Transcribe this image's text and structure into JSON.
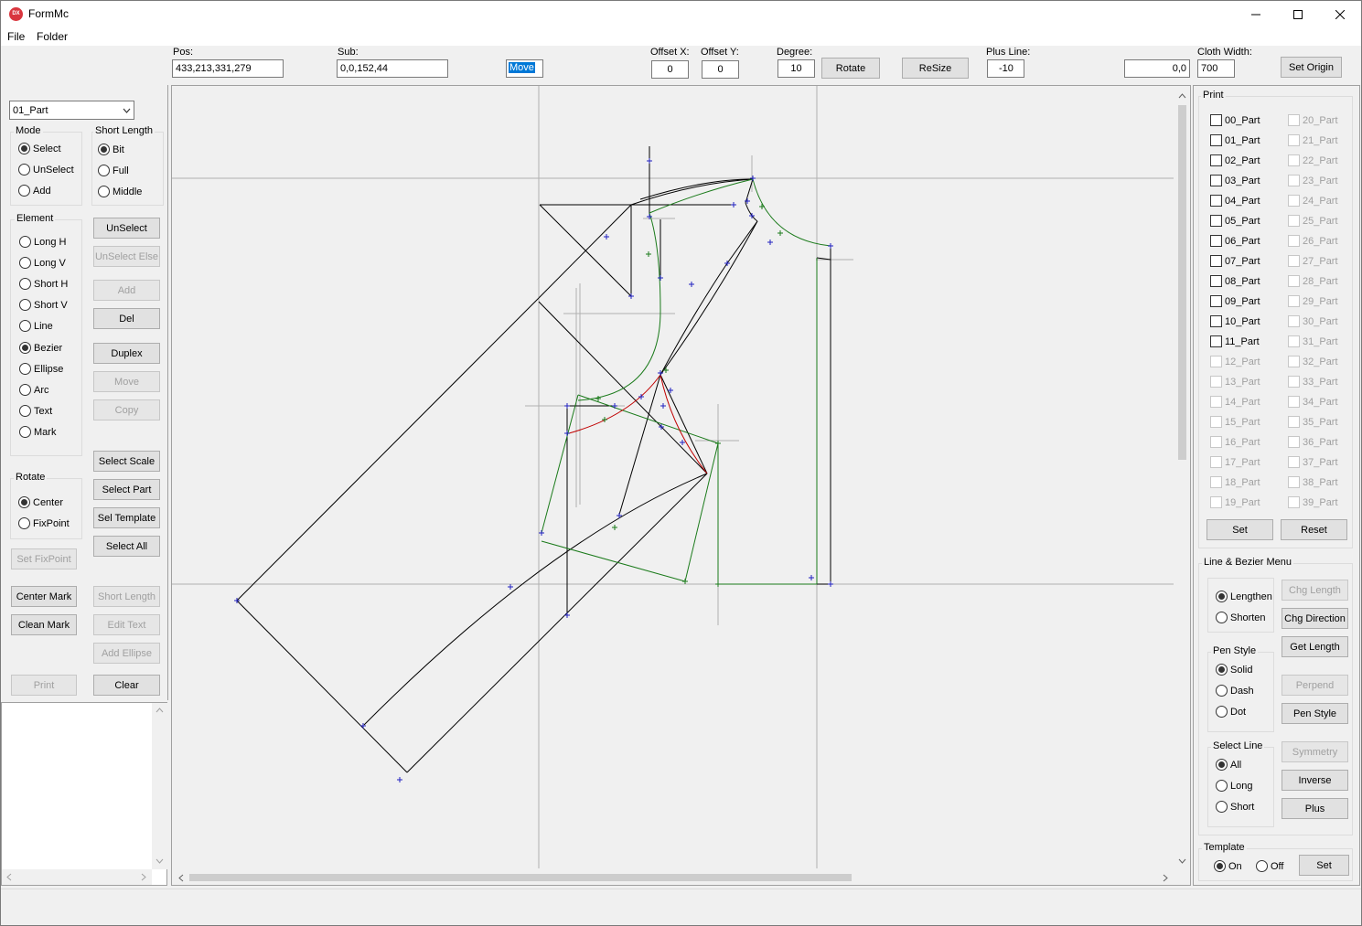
{
  "window": {
    "title": "FormMc",
    "icon": "app-icon"
  },
  "menu": {
    "file": "File",
    "folder": "Folder"
  },
  "toolbar": {
    "pos_label": "Pos:",
    "pos_value": "433,213,331,279",
    "sub_label": "Sub:",
    "sub_value": "0,0,152,44",
    "mode_value": "Move",
    "offset_x_label": "Offset X:",
    "offset_x_value": "0",
    "offset_y_label": "Offset Y:",
    "offset_y_value": "0",
    "degree_label": "Degree:",
    "degree_value": "10",
    "rotate_button": "Rotate",
    "resize_button": "ReSize",
    "plus_line_label": "Plus Line:",
    "plus_line_value": "-10",
    "origin_value": "0,0",
    "cloth_width_label": "Cloth Width:",
    "cloth_width_value": "700",
    "set_origin_button": "Set Origin"
  },
  "left": {
    "part_select": "01_Part",
    "mode": {
      "title": "Mode",
      "options": [
        "Select",
        "UnSelect",
        "Add"
      ],
      "selected": "Select"
    },
    "short_length": {
      "title": "Short Length",
      "options": [
        "Bit",
        "Full",
        "Middle"
      ],
      "selected": "Bit"
    },
    "element": {
      "title": "Element",
      "options": [
        "Long H",
        "Long V",
        "Short H",
        "Short V",
        "Line",
        "Bezier",
        "Ellipse",
        "Arc",
        "Text",
        "Mark"
      ],
      "selected": "Bezier"
    },
    "buttons": {
      "unselect": "UnSelect",
      "unselect_else": "UnSelect Else",
      "add": "Add",
      "del": "Del",
      "duplex": "Duplex",
      "move": "Move",
      "copy": "Copy",
      "select_scale": "Select Scale",
      "select_part": "Select Part",
      "sel_template": "Sel Template",
      "select_all": "Select All",
      "set_fixpoint": "Set FixPoint",
      "center_mark": "Center Mark",
      "short_length": "Short Length",
      "clean_mark": "Clean Mark",
      "edit_text": "Edit Text",
      "add_ellipse": "Add Ellipse",
      "print": "Print",
      "clear": "Clear"
    },
    "rotate": {
      "title": "Rotate",
      "options": [
        "Center",
        "FixPoint"
      ],
      "selected": "Center"
    }
  },
  "right": {
    "print": {
      "title": "Print",
      "parts_left": [
        "00_Part",
        "01_Part",
        "02_Part",
        "03_Part",
        "04_Part",
        "05_Part",
        "06_Part",
        "07_Part",
        "08_Part",
        "09_Part",
        "10_Part",
        "11_Part",
        "12_Part",
        "13_Part",
        "14_Part",
        "15_Part",
        "16_Part",
        "17_Part",
        "18_Part",
        "19_Part"
      ],
      "parts_right": [
        "20_Part",
        "21_Part",
        "22_Part",
        "23_Part",
        "24_Part",
        "25_Part",
        "26_Part",
        "27_Part",
        "28_Part",
        "29_Part",
        "30_Part",
        "31_Part",
        "32_Part",
        "33_Part",
        "34_Part",
        "35_Part",
        "36_Part",
        "37_Part",
        "38_Part",
        "39_Part"
      ],
      "enabled_count": 12,
      "set_button": "Set",
      "reset_button": "Reset"
    },
    "line_menu": {
      "title": "Line & Bezier Menu",
      "length_options": [
        "Lengthen",
        "Shorten"
      ],
      "length_selected": "Lengthen",
      "chg_length": "Chg Length",
      "chg_direction": "Chg Direction",
      "get_length": "Get Length",
      "pen_style_title": "Pen Style",
      "pen_options": [
        "Solid",
        "Dash",
        "Dot"
      ],
      "pen_selected": "Solid",
      "perpend": "Perpend",
      "pen_style_button": "Pen Style",
      "select_line_title": "Select Line",
      "select_options": [
        "All",
        "Long",
        "Short"
      ],
      "select_selected": "All",
      "symmetry": "Symmetry",
      "inverse": "Inverse",
      "plus": "Plus"
    },
    "template": {
      "title": "Template",
      "on": "On",
      "off": "Off",
      "selected": "On",
      "set_button": "Set"
    }
  },
  "colors": {
    "pattern_black": "#000000",
    "pattern_green": "#1a7a1a",
    "pattern_red": "#c00000",
    "point_blue": "#2020c0",
    "guide_gray": "#b0b0b0"
  }
}
